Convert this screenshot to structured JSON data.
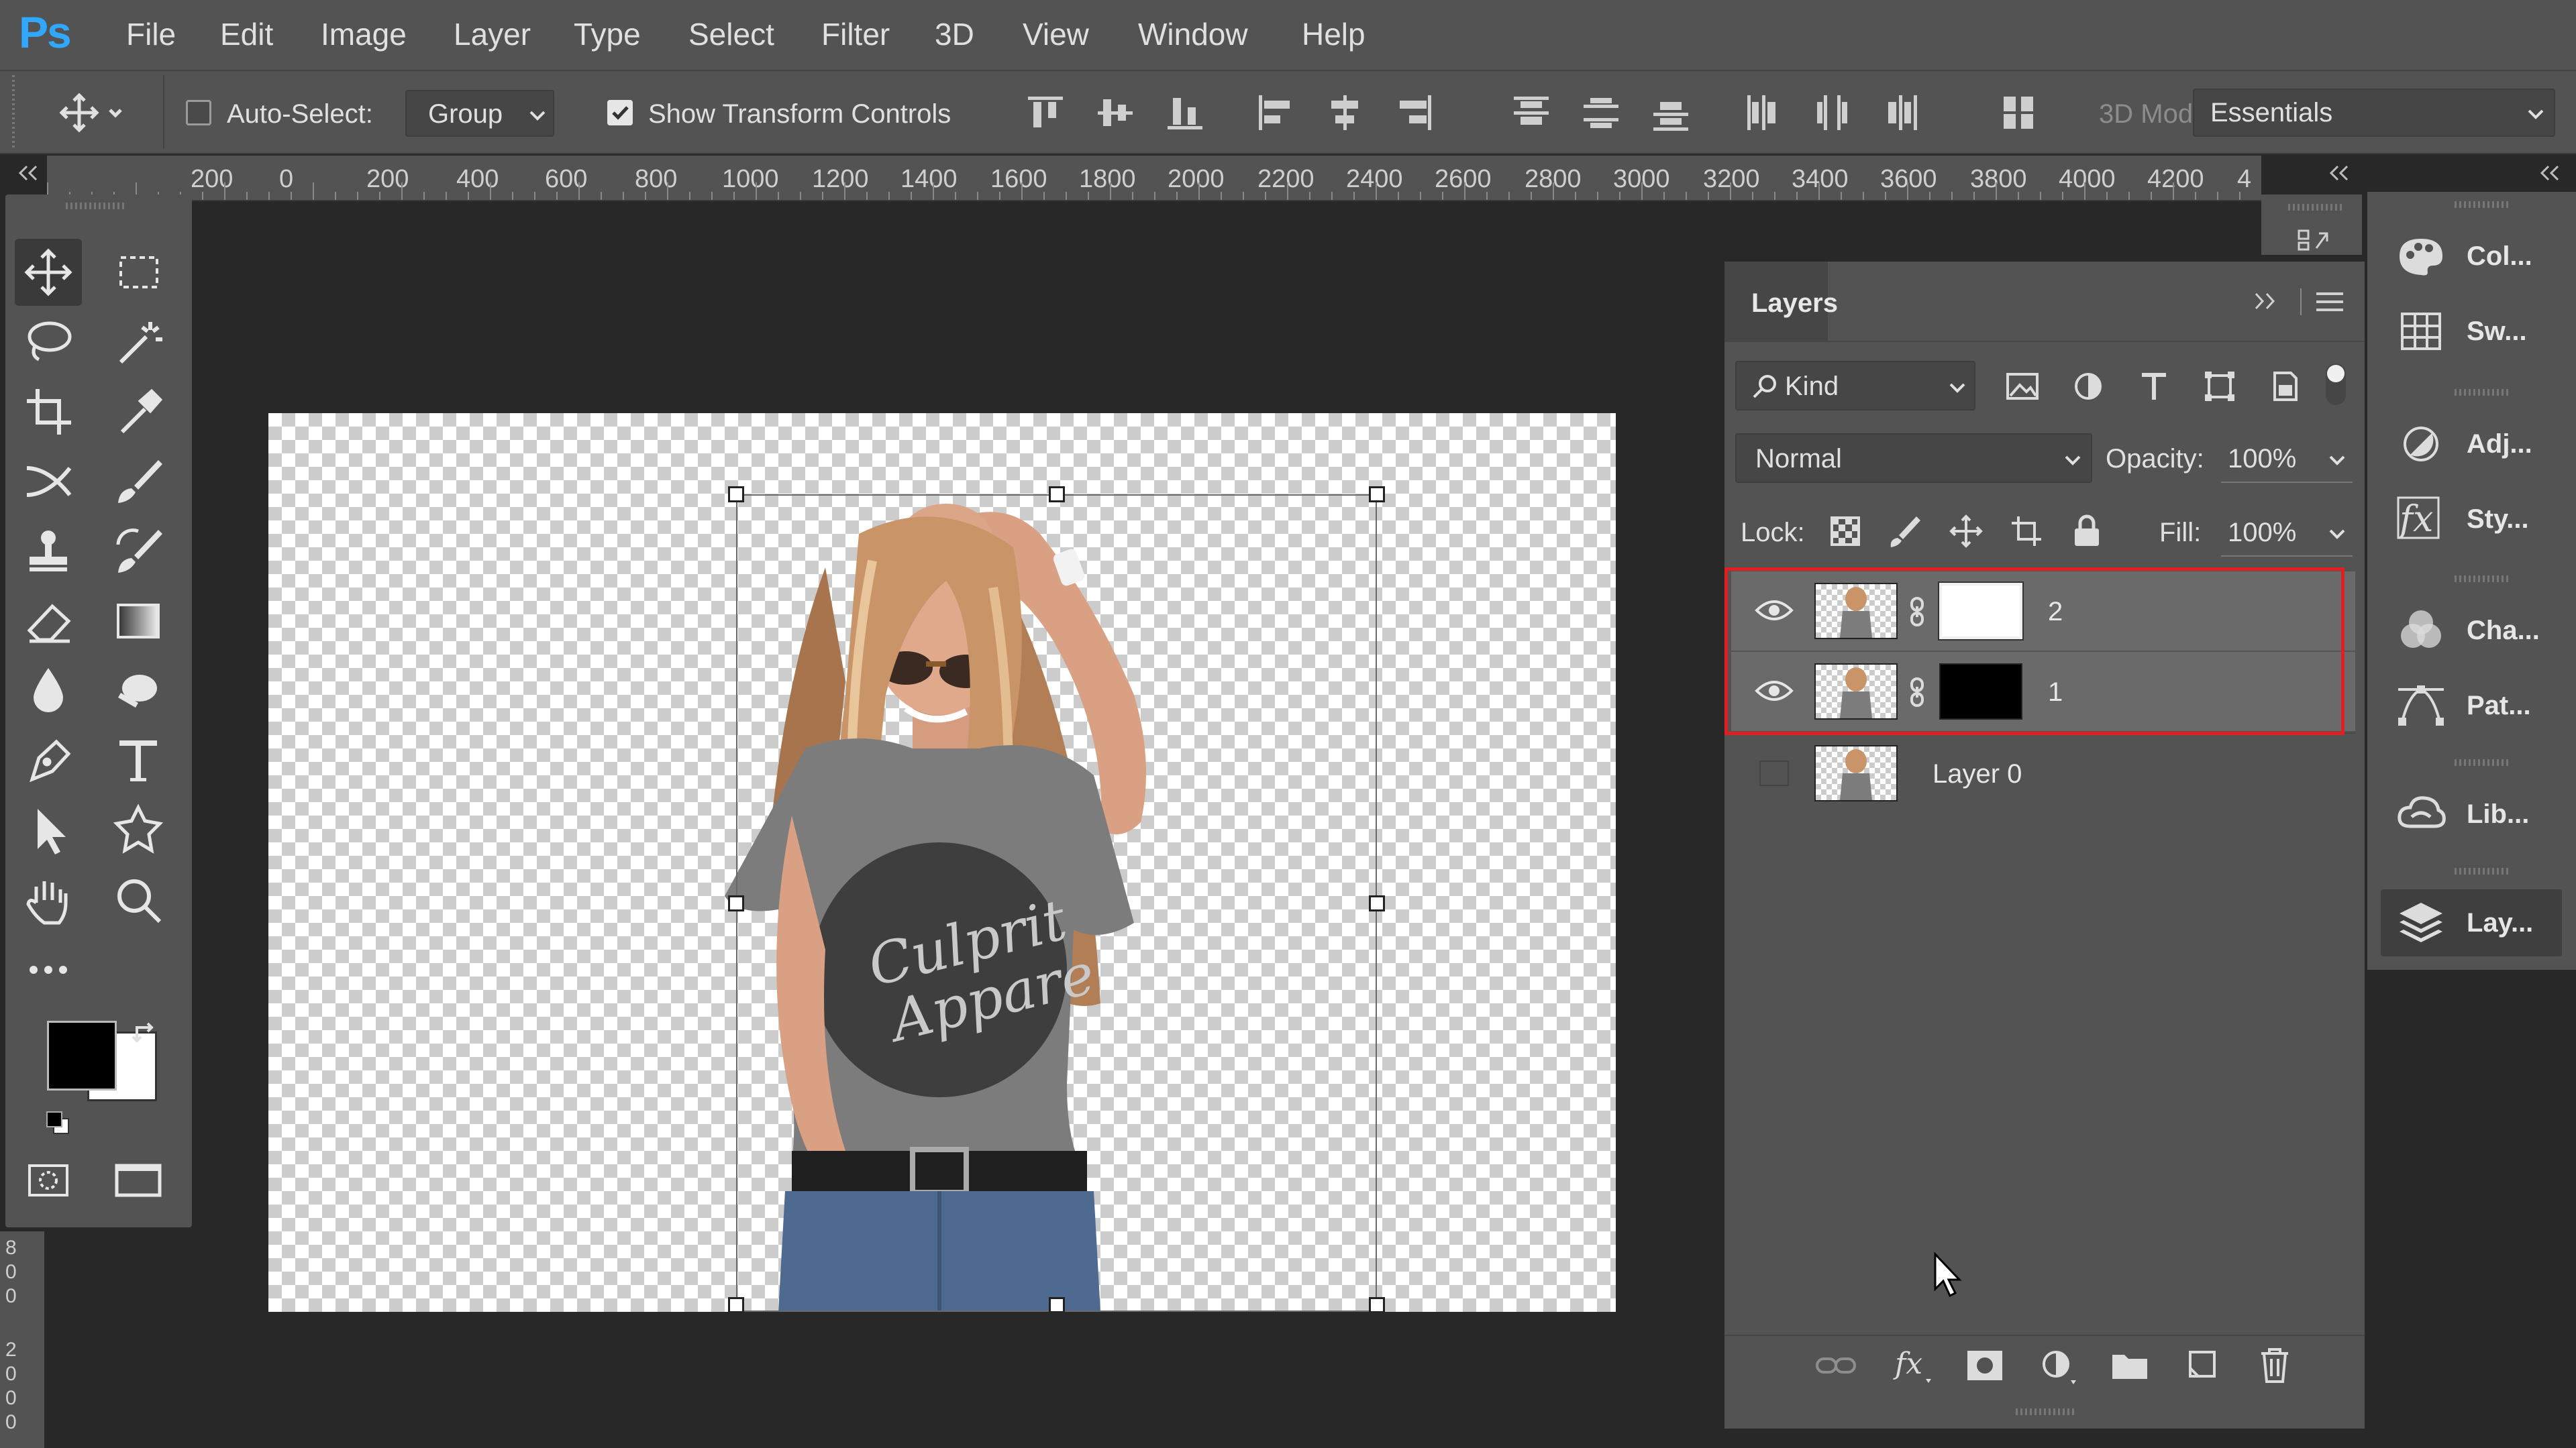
{
  "app": {
    "logo": "Ps"
  },
  "menu": [
    "File",
    "Edit",
    "Image",
    "Layer",
    "Type",
    "Select",
    "Filter",
    "3D",
    "View",
    "Window",
    "Help"
  ],
  "options": {
    "auto_select_label": "Auto-Select:",
    "auto_select_checked": false,
    "group_value": "Group",
    "show_transform_label": "Show Transform Controls",
    "show_transform_checked": true,
    "mode_3d_label": "3D Mod",
    "workspace_value": "Essentials"
  },
  "ruler": {
    "labels": [
      "200",
      "0",
      "200",
      "400",
      "600",
      "800",
      "1000",
      "1200",
      "1400",
      "1600",
      "1800",
      "2000",
      "2200",
      "2400",
      "2600",
      "2800",
      "3000",
      "3200",
      "3400",
      "3600",
      "3800",
      "4000",
      "4200",
      "4"
    ],
    "vertical_labels": [
      "8",
      "0",
      "0",
      "2",
      "0",
      "0",
      "0"
    ]
  },
  "canvas": {
    "shirt_text_line1": "Culprit",
    "shirt_text_line2": "Appare"
  },
  "layers_panel": {
    "tab": "Layers",
    "filter_kind": "Kind",
    "blend_mode": "Normal",
    "opacity_label": "Opacity:",
    "opacity_value": "100%",
    "lock_label": "Lock:",
    "fill_label": "Fill:",
    "fill_value": "100%",
    "layers": [
      {
        "name": "2",
        "visible": true,
        "mask": "white",
        "selected": true
      },
      {
        "name": "1",
        "visible": true,
        "mask": "black",
        "selected": true
      },
      {
        "name": "Layer 0",
        "visible": false,
        "mask": "none",
        "selected": false
      }
    ],
    "highlight_color": "#e02020"
  },
  "dock": {
    "items": [
      {
        "label": "Col...",
        "icon": "color-palette-icon"
      },
      {
        "label": "Sw...",
        "icon": "swatches-grid-icon"
      },
      {
        "label": "Adj...",
        "icon": "adjustments-icon"
      },
      {
        "label": "Sty...",
        "icon": "fx-styles-icon"
      },
      {
        "label": "Cha...",
        "icon": "channels-icon"
      },
      {
        "label": "Pat...",
        "icon": "paths-pen-icon"
      },
      {
        "label": "Lib...",
        "icon": "libraries-cloud-icon"
      },
      {
        "label": "Lay...",
        "icon": "layers-stack-icon"
      }
    ]
  },
  "colors": {
    "foreground": "#000000",
    "background": "#ffffff",
    "ui_panel": "#535353",
    "workspace": "#282828"
  }
}
